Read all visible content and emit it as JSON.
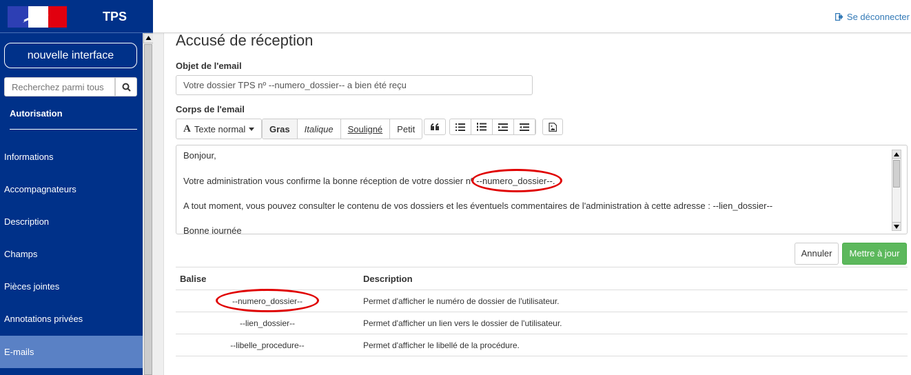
{
  "header": {
    "app_title": "TPS",
    "logout_label": "Se déconnecter"
  },
  "sidebar": {
    "new_interface_label": "nouvelle interface",
    "search_placeholder": "Recherchez parmi tous",
    "section_title": "Autorisation",
    "items": [
      {
        "label": "Informations"
      },
      {
        "label": "Accompagnateurs"
      },
      {
        "label": "Description"
      },
      {
        "label": "Champs"
      },
      {
        "label": "Pièces jointes"
      },
      {
        "label": "Annotations privées"
      },
      {
        "label": "E-mails"
      }
    ],
    "active_item": "E-mails"
  },
  "main": {
    "title": "Accusé de réception",
    "subject_label": "Objet de l'email",
    "subject_value": "Votre dossier TPS nº --numero_dossier-- a bien été reçu",
    "body_label": "Corps de l'email",
    "toolbar": {
      "font_style": "Texte normal",
      "bold": "Gras",
      "italic": "Italique",
      "underline": "Souligné",
      "small": "Petit"
    },
    "body_lines": [
      "Bonjour,",
      "Votre administration vous confirme la bonne réception de votre dossier nº --numero_dossier--.",
      "A tout moment, vous pouvez consulter le contenu de vos dossiers et les éventuels commentaires de l'administration à cette adresse : --lien_dossier--",
      "Bonne journée"
    ],
    "cancel_label": "Annuler",
    "update_label": "Mettre à jour",
    "table": {
      "headers": [
        "Balise",
        "Description"
      ],
      "rows": [
        {
          "tag": "--numero_dossier--",
          "description": "Permet d'afficher le numéro de dossier de l'utilisateur."
        },
        {
          "tag": "--lien_dossier--",
          "description": "Permet d'afficher un lien vers le dossier de l'utilisateur."
        },
        {
          "tag": "--libelle_procedure--",
          "description": "Permet d'afficher le libellé de la procédure."
        }
      ]
    }
  },
  "colors": {
    "sidebar_bg": "#003189",
    "active_item_bg": "#5a81c5",
    "link": "#337ab7",
    "primary_green": "#5cb85c",
    "annotation_red": "#e00000"
  }
}
